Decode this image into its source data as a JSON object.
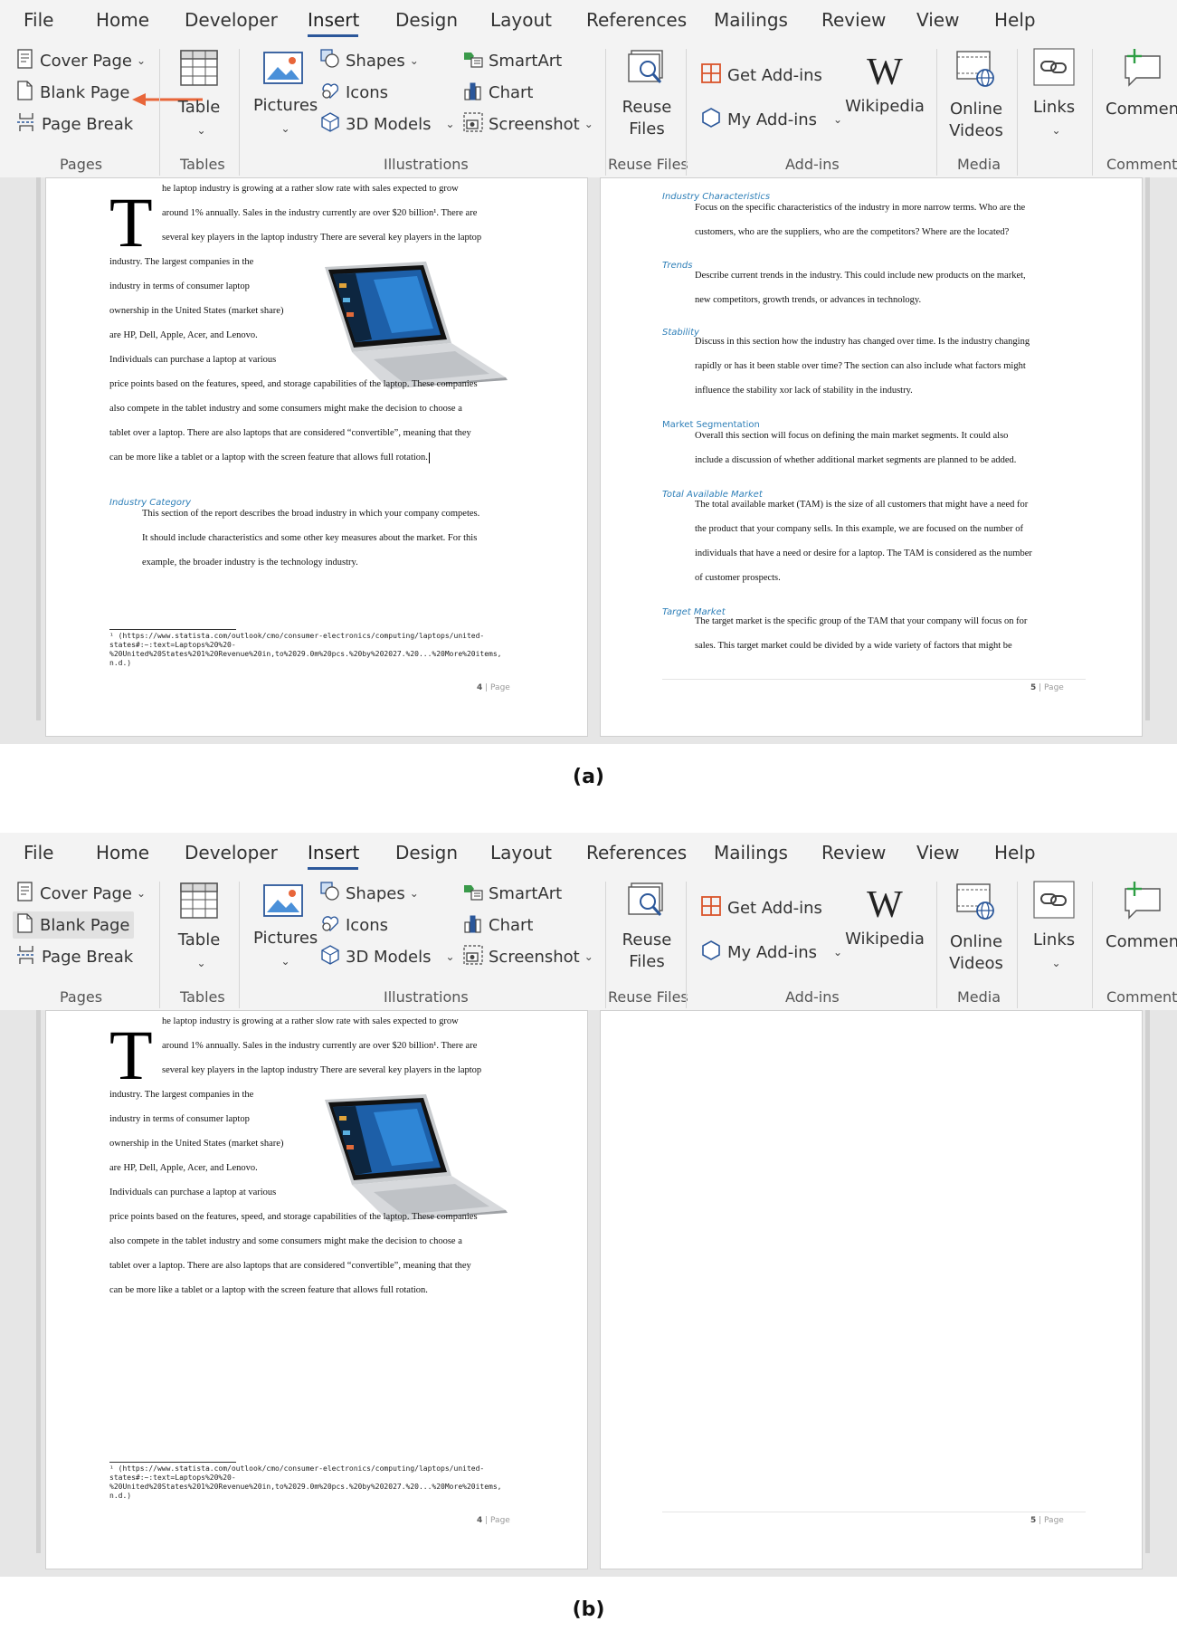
{
  "ribbon": {
    "tabs": [
      "File",
      "Home",
      "Developer",
      "Insert",
      "Design",
      "Layout",
      "References",
      "Mailings",
      "Review",
      "View",
      "Help"
    ],
    "active_tab": "Insert",
    "pages_group": {
      "label": "Pages",
      "cover_page": "Cover Page",
      "blank_page": "Blank Page",
      "page_break": "Page Break"
    },
    "tables_group": {
      "label": "Tables",
      "table": "Table"
    },
    "illustrations_group": {
      "label": "Illustrations",
      "pictures": "Pictures",
      "shapes": "Shapes",
      "icons": "Icons",
      "models_3d": "3D Models",
      "smartart": "SmartArt",
      "chart": "Chart",
      "screenshot": "Screenshot"
    },
    "reuse_files_group": {
      "label": "Reuse Files",
      "reuse_line1": "Reuse",
      "reuse_line2": "Files"
    },
    "addins_group": {
      "label": "Add-ins",
      "get_addins": "Get Add-ins",
      "my_addins": "My Add-ins",
      "wikipedia": "Wikipedia"
    },
    "media_group": {
      "label": "Media",
      "online_line1": "Online",
      "online_line2": "Videos"
    },
    "links_group": {
      "links": "Links"
    },
    "comments_group": {
      "label": "Comments",
      "comment": "Commen"
    }
  },
  "document": {
    "page4": {
      "dropcap": "T",
      "intro_lines": [
        "he laptop industry is growing at a rather slow rate with sales expected to grow",
        "around 1% annually.  Sales in the industry currently are over $20 billion¹.  There are",
        "several key players in the laptop industry There are several key players in the laptop"
      ],
      "wrap_lines": [
        "industry.  The largest companies in the",
        "industry in terms of consumer laptop",
        "ownership in the United States (market share)",
        "are HP, Dell, Apple, Acer, and Lenovo.",
        "Individuals can purchase a laptop at various"
      ],
      "full_lines": [
        "price points based on the features, speed, and storage capabilities of the laptop. These companies",
        "also compete in the tablet industry and some consumers might make the decision to choose a",
        "tablet over a laptop.  There are also laptops that are considered “convertible”, meaning that they",
        "can be more like a tablet or a laptop with the screen feature that allows full rotation."
      ],
      "industry_category": {
        "heading": "Industry Category",
        "lines": [
          "This section of the report describes the broad industry in which your company competes.",
          "It should include characteristics and some other key measures about the market.  For this",
          "example, the broader industry is the technology industry."
        ]
      },
      "footnote_lines": [
        "¹ (https://www.statista.com/outlook/cmo/consumer-electronics/computing/laptops/united-",
        "states#:~:text=Laptops%20%20-",
        "%20United%20States%201%20Revenue%20in,to%2029.0m%20pcs.%20by%202027.%20...%20More%20items,",
        "n.d.)"
      ],
      "page_number": "4",
      "page_word": "Page"
    },
    "page5": {
      "sections": [
        {
          "heading": "Industry Characteristics",
          "lines": [
            "Focus on the specific characteristics of the industry in more narrow terms.  Who are the",
            "customers, who are the suppliers, who are the competitors? Where are the located?"
          ]
        },
        {
          "heading": "Trends",
          "lines": [
            "Describe current trends in the industry.  This could include new products on the market,",
            "new competitors, growth trends, or advances in technology."
          ]
        },
        {
          "heading": "Stability",
          "lines": [
            "Discuss in this section how the industry has changed over time.  Is the industry changing",
            "rapidly or has it been stable over time? The section can also include what factors might",
            "influence the stability xor lack of stability in the industry."
          ]
        },
        {
          "heading": "Market Segmentation",
          "lines": [
            "Overall this section will focus on defining the main market segments.  It could also",
            "include a discussion of whether additional market segments are planned to be added."
          ]
        },
        {
          "heading": "Total Available Market",
          "lines": [
            "The total available market (TAM) is the size of all customers that might have a need for",
            "the product that your company sells.  In this example, we are focused on the number of",
            "individuals that have a need or desire for a laptop.  The TAM is considered as the number",
            "of customer prospects."
          ]
        },
        {
          "heading": "Target Market",
          "lines": [
            "The target market is the specific group of the TAM that your company will focus on for",
            "sales.  This target market could be divided by a wide variety of factors that might be"
          ]
        }
      ],
      "page_number": "5",
      "page_word": "Page"
    }
  },
  "labels": {
    "a": "(a)",
    "b": "(b)"
  },
  "colors": {
    "accent": "#2b579a",
    "heading": "#2e7fb8",
    "arrow": "#e8663a",
    "ribbon": "#f3f3f3",
    "canvas": "#e6e6e6"
  }
}
